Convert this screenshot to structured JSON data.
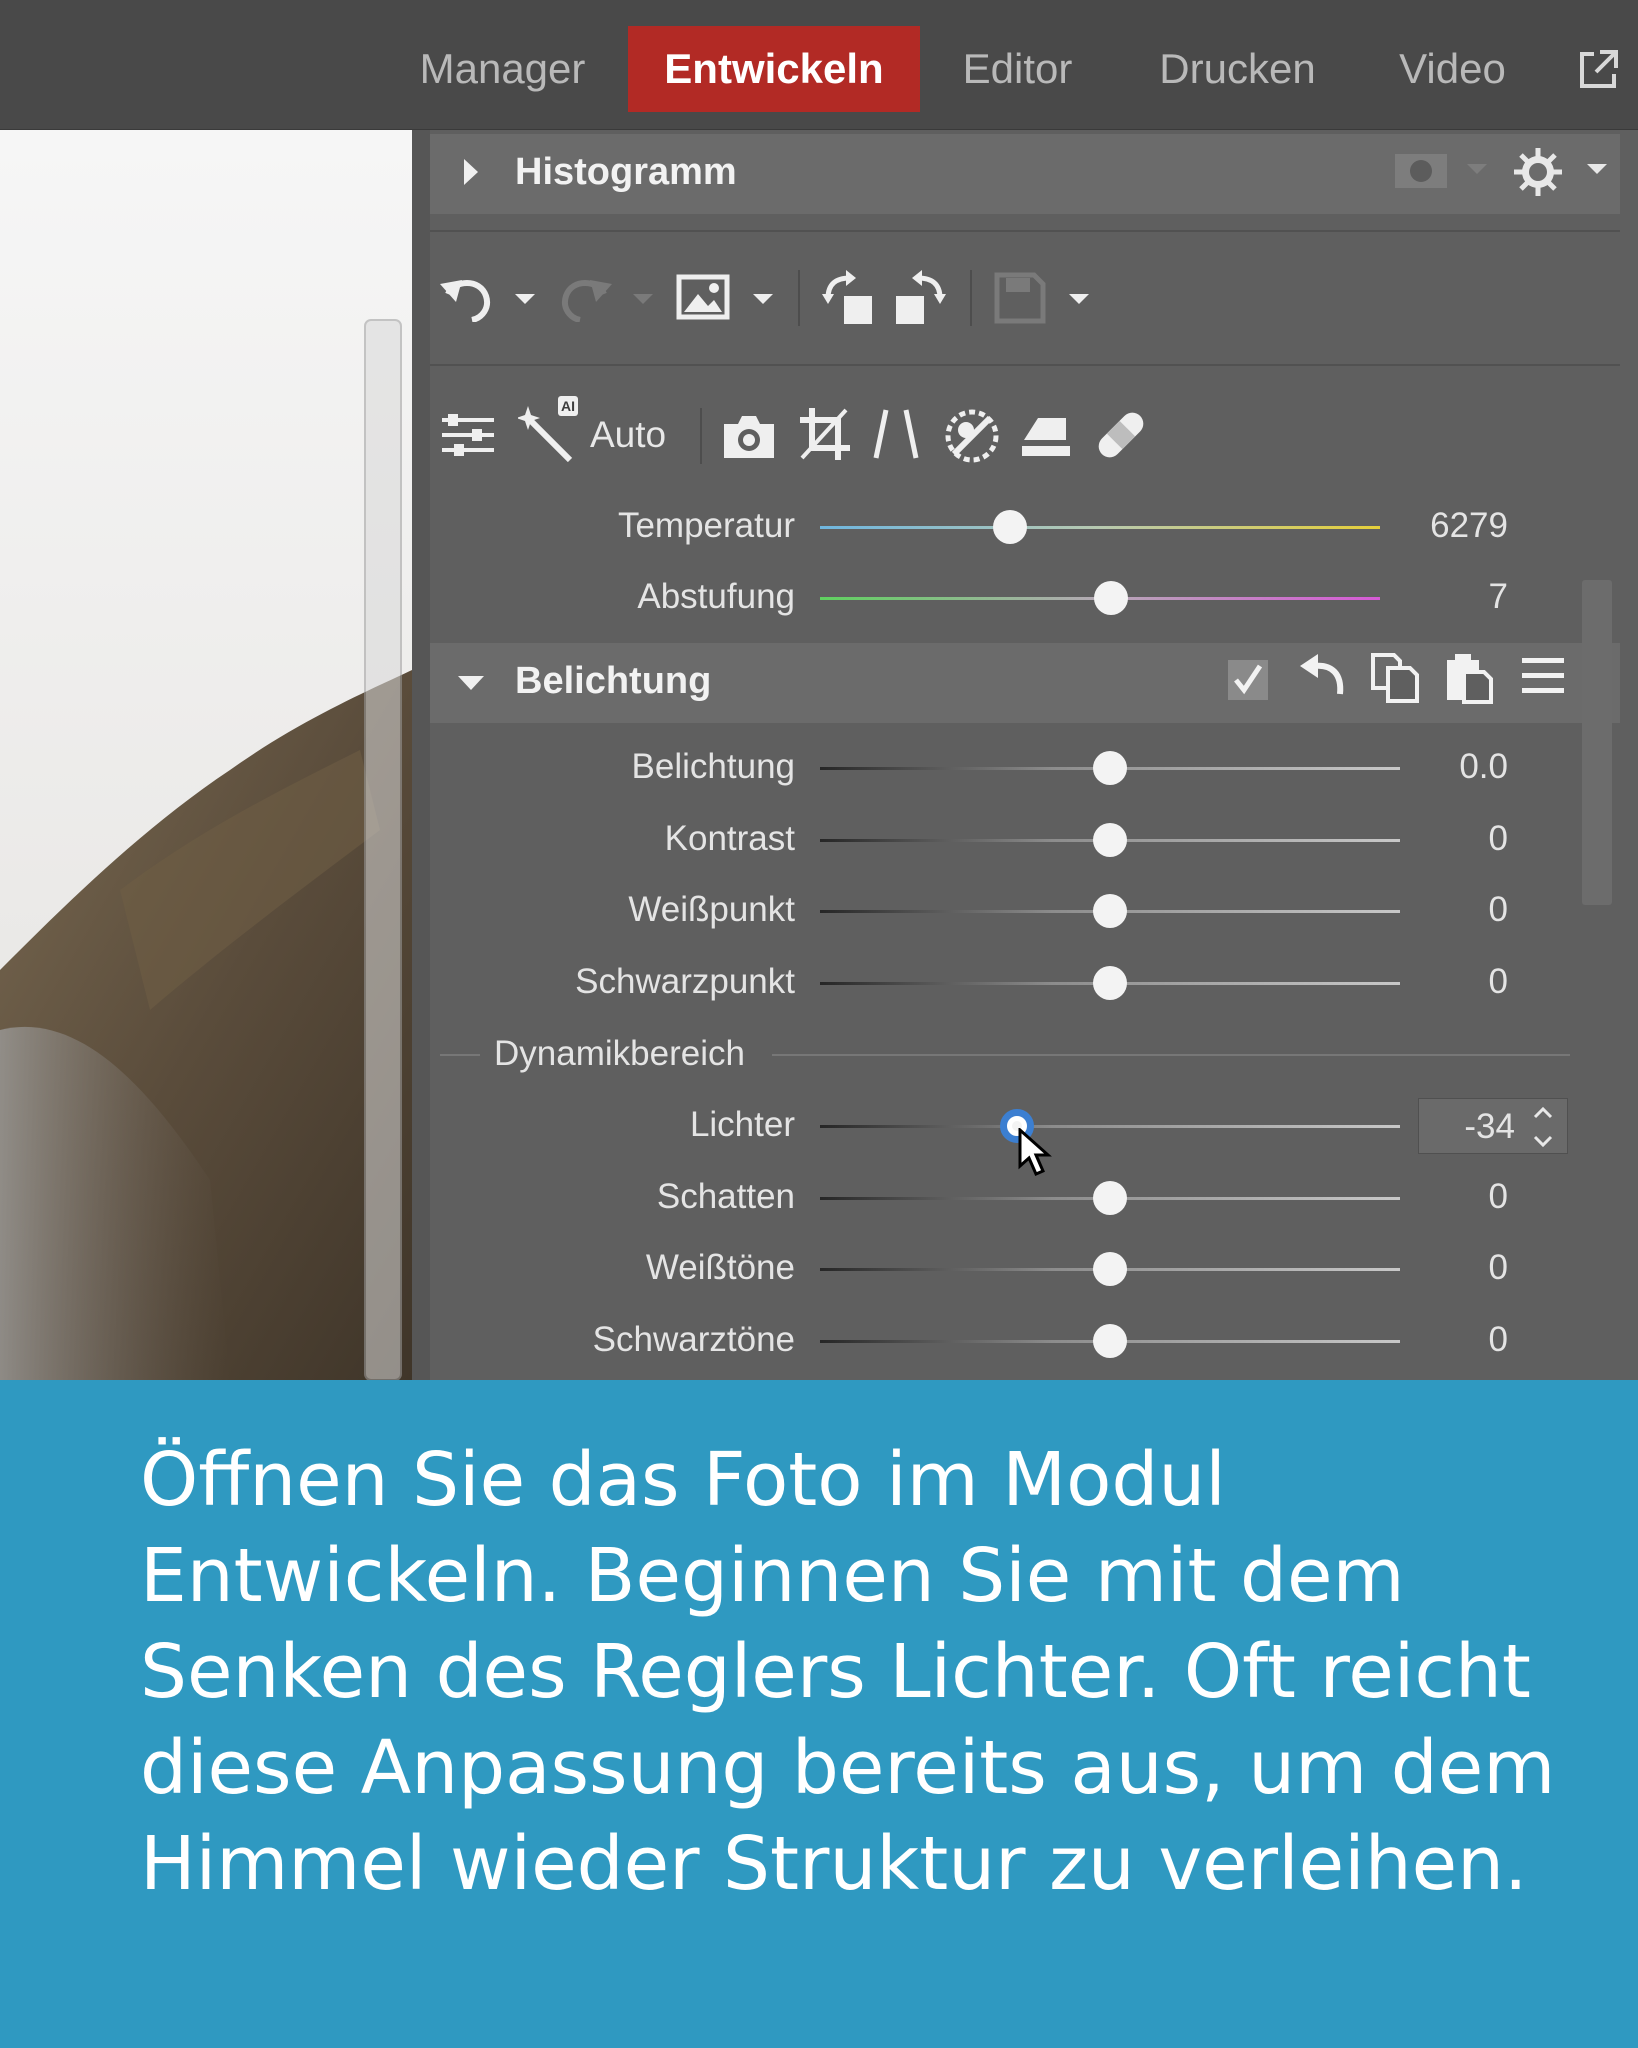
{
  "nav": {
    "tabs": [
      {
        "label": "Manager",
        "active": false
      },
      {
        "label": "Entwickeln",
        "active": true
      },
      {
        "label": "Editor",
        "active": false
      },
      {
        "label": "Drucken",
        "active": false
      },
      {
        "label": "Video",
        "active": false
      }
    ],
    "external_icon": "external-window-icon"
  },
  "panel": {
    "histogram": {
      "title": "Histogramm",
      "icons": [
        "mask-icon",
        "gear-icon"
      ]
    },
    "toolbar_icons": [
      "undo-icon",
      "redo-icon",
      "image-icon",
      "rotate-left-icon",
      "rotate-right-icon",
      "save-icon"
    ],
    "tools": {
      "auto_label": "Auto",
      "ai_badge": "AI",
      "icons": [
        "sliders-icon",
        "auto-wand-icon",
        "camera-icon",
        "crop-icon",
        "perspective-icon",
        "color-icon",
        "stamp-icon",
        "bandage-icon"
      ]
    },
    "white_balance": [
      {
        "label": "Temperatur",
        "value": "6279",
        "position": 0.34
      },
      {
        "label": "Abstufung",
        "value": "7",
        "position": 0.52
      }
    ],
    "exposure": {
      "title": "Belichtung",
      "header_icons": [
        "checkbox-icon",
        "reset-icon",
        "copy-icon",
        "paste-icon",
        "menu-icon"
      ],
      "sliders": [
        {
          "label": "Belichtung",
          "value": "0.0",
          "position": 0.5
        },
        {
          "label": "Kontrast",
          "value": "0",
          "position": 0.5
        },
        {
          "label": "Weißpunkt",
          "value": "0",
          "position": 0.5
        },
        {
          "label": "Schwarzpunkt",
          "value": "0",
          "position": 0.5
        }
      ],
      "dynamic_range": {
        "title": "Dynamikbereich",
        "sliders": [
          {
            "label": "Lichter",
            "value": "-34",
            "position": 0.34,
            "active": true
          },
          {
            "label": "Schatten",
            "value": "0",
            "position": 0.5
          },
          {
            "label": "Weißtöne",
            "value": "0",
            "position": 0.5
          },
          {
            "label": "Schwarztöne",
            "value": "0",
            "position": 0.5
          }
        ]
      }
    }
  },
  "caption": {
    "text": "Öffnen Sie das Foto im Modul Entwickeln. Beginnen Sie mit dem Senken des Reglers Lichter. Oft reicht diese Anpassung bereits aus, um dem Himmel wieder Struktur zu verleihen."
  },
  "colors": {
    "active_tab": "#b22a25",
    "caption_bg": "#2f99c1",
    "panel_bg": "#5f5f5f",
    "slider_focus": "#3c7fd1"
  }
}
